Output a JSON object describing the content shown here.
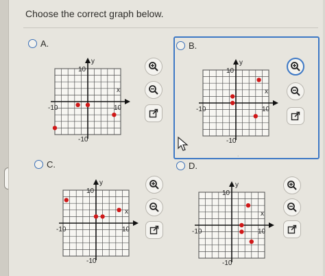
{
  "question": {
    "prompt": "Choose the correct graph below."
  },
  "options": [
    {
      "id": "A",
      "label": "A.",
      "points": [
        [
          -10,
          -8
        ],
        [
          -3,
          -1
        ],
        [
          0,
          -1
        ],
        [
          8,
          -4
        ]
      ]
    },
    {
      "id": "B",
      "label": "B.",
      "points": [
        [
          -1,
          2
        ],
        [
          -1,
          0
        ],
        [
          7,
          7
        ],
        [
          6,
          -4
        ]
      ]
    },
    {
      "id": "C",
      "label": "C.",
      "points": [
        [
          -9,
          7
        ],
        [
          0,
          2
        ],
        [
          2,
          2
        ],
        [
          7,
          4
        ]
      ]
    },
    {
      "id": "D",
      "label": "D.",
      "points": [
        [
          6,
          -5
        ],
        [
          3,
          0
        ],
        [
          3,
          -2
        ],
        [
          5,
          6
        ]
      ]
    }
  ],
  "graph_axis": {
    "x_label": "x",
    "y_label": "y",
    "tick_min": "-10",
    "tick_max": "10",
    "range": [
      -10,
      10
    ],
    "grid_step": 2
  },
  "colors": {
    "accent": "#3d78c5",
    "point": "#d01818"
  },
  "icons": [
    "zoom-in-icon",
    "zoom-out-icon",
    "popout-icon"
  ]
}
